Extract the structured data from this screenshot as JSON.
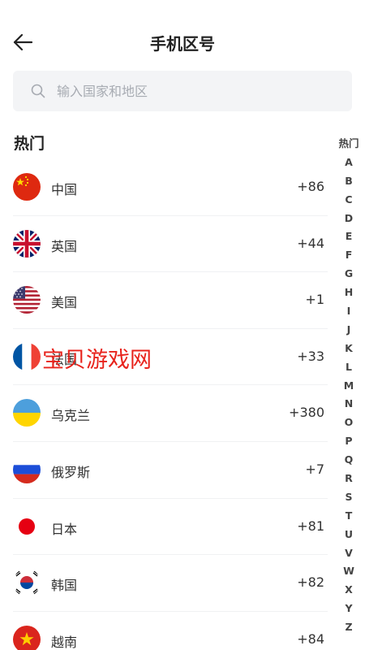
{
  "header": {
    "title": "手机区号"
  },
  "search": {
    "placeholder": "输入国家和地区"
  },
  "section": {
    "hot_title": "热门"
  },
  "countries": [
    {
      "name": "中国",
      "code": "+86",
      "flag": "china-flag-icon"
    },
    {
      "name": "英国",
      "code": "+44",
      "flag": "uk-flag-icon"
    },
    {
      "name": "美国",
      "code": "+1",
      "flag": "usa-flag-icon"
    },
    {
      "name": "法国",
      "code": "+33",
      "flag": "france-flag-icon"
    },
    {
      "name": "乌克兰",
      "code": "+380",
      "flag": "ukraine-flag-icon"
    },
    {
      "name": "俄罗斯",
      "code": "+7",
      "flag": "russia-flag-icon"
    },
    {
      "name": "日本",
      "code": "+81",
      "flag": "japan-flag-icon"
    },
    {
      "name": "韩国",
      "code": "+82",
      "flag": "korea-flag-icon"
    },
    {
      "name": "越南",
      "code": "+84",
      "flag": "vietnam-flag-icon"
    }
  ],
  "index": [
    "热门",
    "A",
    "B",
    "C",
    "D",
    "E",
    "F",
    "G",
    "H",
    "I",
    "J",
    "K",
    "L",
    "M",
    "N",
    "O",
    "P",
    "Q",
    "R",
    "S",
    "T",
    "U",
    "V",
    "W",
    "X",
    "Y",
    "Z"
  ],
  "watermark": "宝贝游戏网",
  "colors": {
    "accent": "#e8231c",
    "search_bg": "#f3f4f6"
  }
}
